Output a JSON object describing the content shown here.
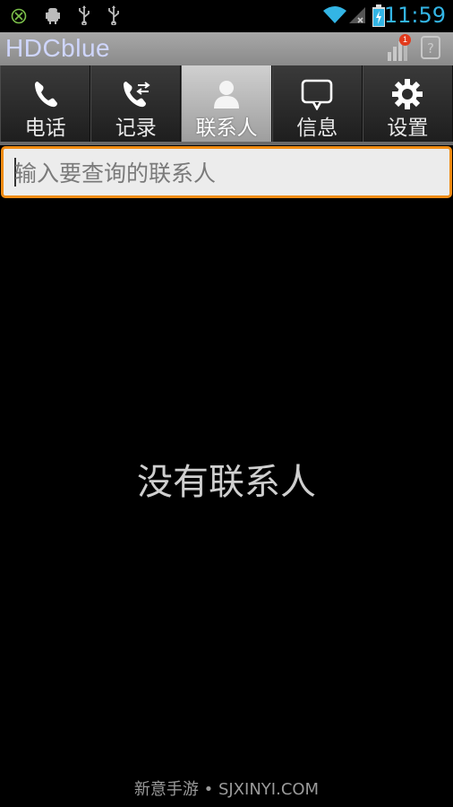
{
  "status_bar": {
    "time": "11:59",
    "left_icons": [
      "xbox-icon",
      "android-debug-icon",
      "usb-icon",
      "usb-icon"
    ],
    "right_icons": [
      "wifi-icon",
      "no-signal-icon",
      "battery-charging-icon"
    ],
    "accent_color": "#33b5e5"
  },
  "title_bar": {
    "title": "HDCblue",
    "notification_count": "1",
    "icons": [
      "signal-bars-icon",
      "help-icon"
    ]
  },
  "tabs": [
    {
      "label": "电话",
      "icon": "phone-icon",
      "active": false
    },
    {
      "label": "记录",
      "icon": "call-log-icon",
      "active": false
    },
    {
      "label": "联系人",
      "icon": "contact-icon",
      "active": true
    },
    {
      "label": "信息",
      "icon": "message-icon",
      "active": false
    },
    {
      "label": "设置",
      "icon": "gear-icon",
      "active": false
    }
  ],
  "search": {
    "placeholder": "输入要查询的联系人",
    "value": "",
    "border_color": "#f08c14"
  },
  "empty_state": {
    "message": "没有联系人"
  },
  "footer": {
    "watermark": "新意手游 • SJXINYI.COM"
  }
}
